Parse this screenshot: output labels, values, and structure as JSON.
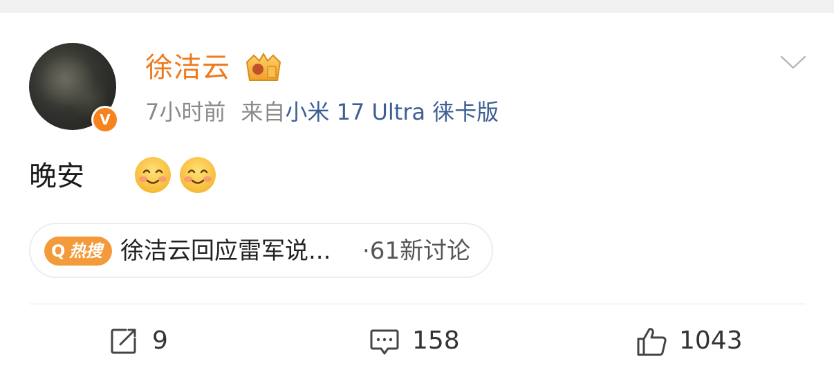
{
  "post": {
    "author": "徐洁云",
    "time": "7小时前",
    "source_prefix": "来自",
    "source": "小米 17 Ultra 徕卡版",
    "text": "晚安",
    "verified_mark": "V"
  },
  "hot_search": {
    "badge": "热搜",
    "title": "徐洁云回应雷军说...",
    "count": "·61新讨论"
  },
  "actions": {
    "share_count": "9",
    "comment_count": "158",
    "like_count": "1043"
  },
  "colors": {
    "author": "#ee7a1e",
    "source_link": "#3d5f93",
    "hot_badge": "#f39b3b",
    "verified": "#f7831f"
  },
  "icons": [
    "crown-badge-icon",
    "chevron-down-icon",
    "smile-emoji-icon",
    "share-icon",
    "comment-icon",
    "like-icon"
  ]
}
